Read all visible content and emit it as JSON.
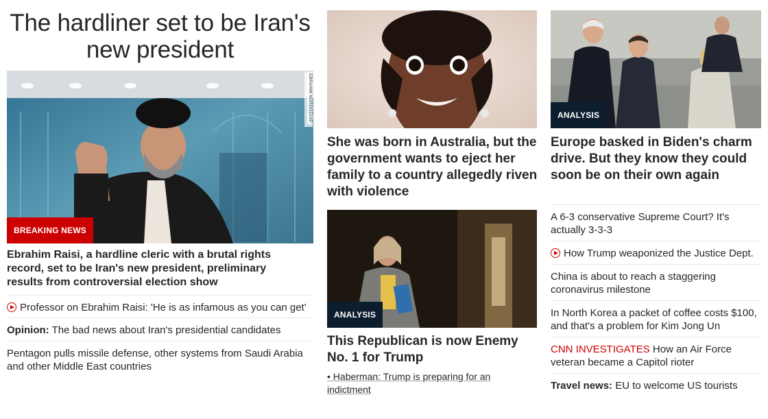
{
  "colors": {
    "breaking_red": "#cc0000",
    "analysis_dark": "#0c1e2e",
    "text": "#262626"
  },
  "col1": {
    "headline": "The hardliner set to be Iran's new president",
    "image_alt": "Ebrahim Raisi waving",
    "photo_credit": "EBRAHIM NOROOZI/AP",
    "badge": "BREAKING NEWS",
    "main_story": "Ebrahim Raisi, a hardline cleric with a brutal rights record, set to be Iran's new president, preliminary results from controversial election show",
    "links": [
      {
        "icon": "play-icon",
        "text": "Professor on Ebrahim Raisi: 'He is as infamous as you can get'"
      },
      {
        "prefix": "Opinion:",
        "text": " The bad news about Iran's presidential candidates"
      },
      {
        "text": "Pentagon pulls missile defense, other systems from Saudi Arabia and other Middle East countries"
      }
    ]
  },
  "col2": {
    "story1": {
      "title": "She was born in Australia, but the government wants to eject her family to a country allegedly riven with violence"
    },
    "story2": {
      "badge": "ANALYSIS",
      "title": "This Republican is now Enemy No. 1 for Trump",
      "related": "• Haberman: Trump is preparing for an indictment"
    }
  },
  "col3": {
    "story": {
      "badge": "ANALYSIS",
      "title": "Europe basked in Biden's charm drive. But they know they could soon be on their own again"
    },
    "links": [
      {
        "text": "A 6-3 conservative Supreme Court? It's actually 3-3-3"
      },
      {
        "icon": "play-icon",
        "text": "How Trump weaponized the Justice Dept."
      },
      {
        "text": "China is about to reach a staggering coronavirus milestone"
      },
      {
        "text": "In North Korea a packet of coffee costs $100, and that's a problem for Kim Jong Un"
      },
      {
        "prefix_red": "CNN INVESTIGATES",
        "text": " How an Air Force veteran became a Capitol rioter"
      },
      {
        "prefix": "Travel news:",
        "text": " EU to welcome US tourists"
      }
    ]
  }
}
